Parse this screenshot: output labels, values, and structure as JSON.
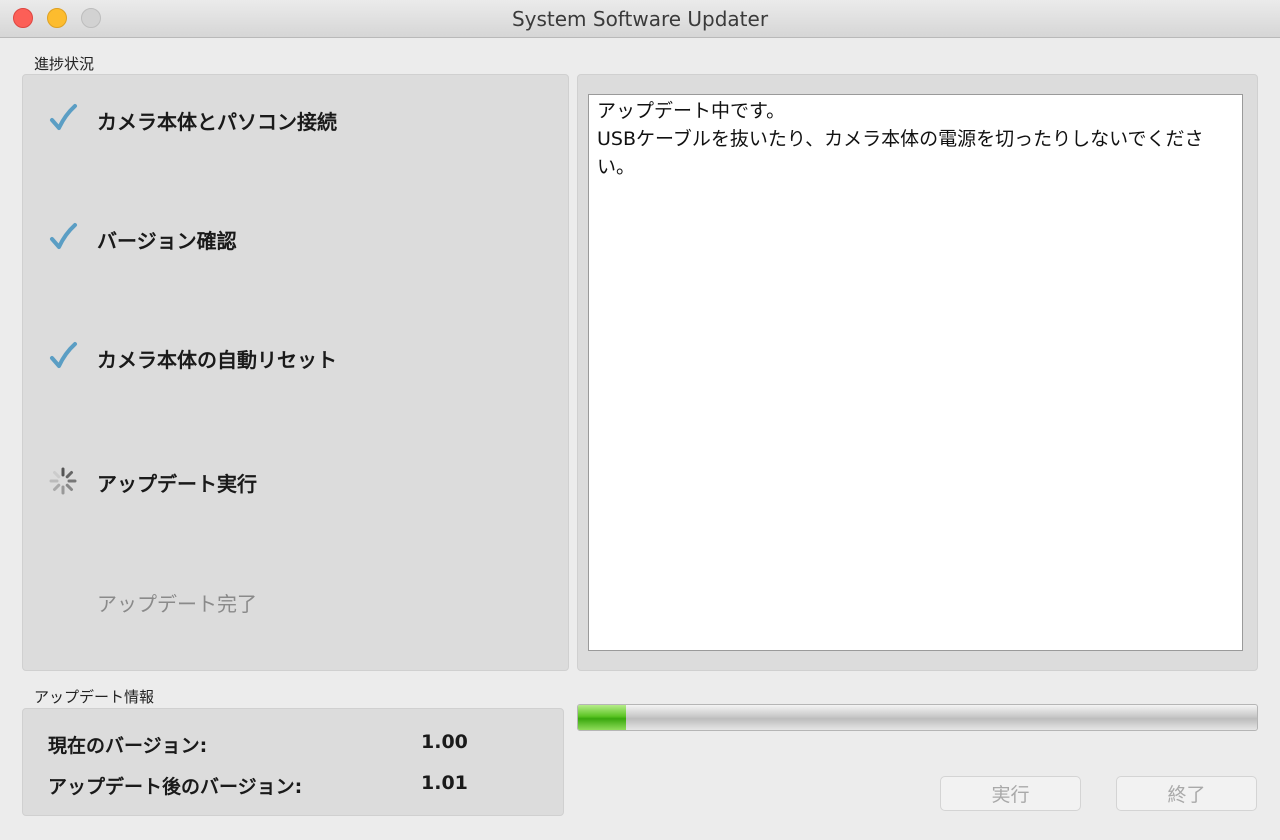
{
  "window": {
    "title": "System Software Updater"
  },
  "progress_section": {
    "label": "進捗状況",
    "steps": [
      {
        "label": "カメラ本体とパソコン接続",
        "state": "done"
      },
      {
        "label": "バージョン確認",
        "state": "done"
      },
      {
        "label": "カメラ本体の自動リセット",
        "state": "done"
      },
      {
        "label": "アップデート実行",
        "state": "in-progress"
      },
      {
        "label": "アップデート完了",
        "state": "pending"
      }
    ]
  },
  "message": {
    "line1": "アップデート中です。",
    "line2": "USBケーブルを抜いたり、カメラ本体の電源を切ったりしないでください。"
  },
  "update_info": {
    "label": "アップデート情報",
    "current_label": "現在のバージョン:",
    "current_value": "1.00",
    "after_label": "アップデート後のバージョン:",
    "after_value": "1.01"
  },
  "progress_bar": {
    "value": 0.07
  },
  "buttons": {
    "run_label": "実行",
    "quit_label": "終了"
  },
  "colors": {
    "check": "#5b9ec4",
    "progress_green": "#4cb81a"
  },
  "icons": {
    "done": "checkmark-icon",
    "in_progress": "spinner-icon"
  }
}
